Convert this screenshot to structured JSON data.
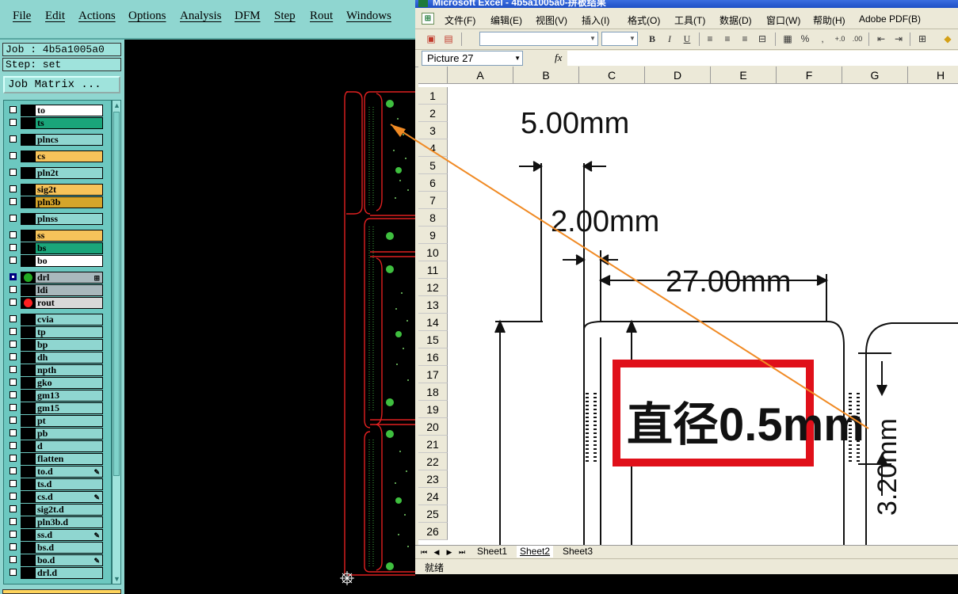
{
  "cam_app": {
    "menu": [
      "File",
      "Edit",
      "Actions",
      "Options",
      "Analysis",
      "DFM",
      "Step",
      "Rout",
      "Windows"
    ],
    "job_label": "Job : 4b5a1005a0",
    "step_label": "Step: set",
    "job_matrix_button": "Job Matrix ...",
    "layers": [
      {
        "name": "to",
        "color": "#ffffff"
      },
      {
        "name": "ts",
        "color": "#1aa57a"
      },
      {
        "name": "plncs",
        "color": "#8fd6d0"
      },
      {
        "name": "cs",
        "color": "#f6c35a"
      },
      {
        "name": "pln2t",
        "color": "#8fd6d0"
      },
      {
        "name": "sig2t",
        "color": "#f6c35a"
      },
      {
        "name": "pln3b",
        "color": "#d6a52a"
      },
      {
        "name": "plnss",
        "color": "#8fd6d0"
      },
      {
        "name": "ss",
        "color": "#f6c35a"
      },
      {
        "name": "bs",
        "color": "#1aa57a"
      },
      {
        "name": "bo",
        "color": "#ffffff"
      },
      {
        "name": "drl",
        "color": "#a9b8bc",
        "dot": "#22aa22",
        "flag": "⊞",
        "active": true
      },
      {
        "name": "ldi",
        "color": "#a9b8bc"
      },
      {
        "name": "rout",
        "color": "#d8d8d8",
        "dot": "#ff2020"
      },
      {
        "name": "cvia",
        "color": "#8fd6d0"
      },
      {
        "name": "tp",
        "color": "#8fd6d0"
      },
      {
        "name": "bp",
        "color": "#8fd6d0"
      },
      {
        "name": "dh",
        "color": "#8fd6d0"
      },
      {
        "name": "npth",
        "color": "#8fd6d0"
      },
      {
        "name": "gko",
        "color": "#8fd6d0"
      },
      {
        "name": "gm13",
        "color": "#8fd6d0"
      },
      {
        "name": "gm15",
        "color": "#8fd6d0"
      },
      {
        "name": "pt",
        "color": "#8fd6d0"
      },
      {
        "name": "pb",
        "color": "#8fd6d0"
      },
      {
        "name": "d",
        "color": "#8fd6d0"
      },
      {
        "name": "flatten",
        "color": "#8fd6d0"
      },
      {
        "name": "to.d",
        "color": "#8fd6d0",
        "flag": "✎"
      },
      {
        "name": "ts.d",
        "color": "#8fd6d0"
      },
      {
        "name": "cs.d",
        "color": "#8fd6d0",
        "flag": "✎"
      },
      {
        "name": "sig2t.d",
        "color": "#8fd6d0"
      },
      {
        "name": "pln3b.d",
        "color": "#8fd6d0"
      },
      {
        "name": "ss.d",
        "color": "#8fd6d0",
        "flag": "✎"
      },
      {
        "name": "bs.d",
        "color": "#8fd6d0"
      },
      {
        "name": "bo.d",
        "color": "#8fd6d0",
        "flag": "✎"
      },
      {
        "name": "drl.d",
        "color": "#8fd6d0"
      }
    ]
  },
  "excel": {
    "title": "Microsoft Excel - 4b5a1005a0-拼板结果",
    "menu": [
      "文件(F)",
      "编辑(E)",
      "视图(V)",
      "插入(I)",
      "格式(O)",
      "工具(T)",
      "数据(D)",
      "窗口(W)",
      "帮助(H)",
      "Adobe PDF(B)"
    ],
    "name_box": "Picture 27",
    "fx_label": "fx",
    "columns": [
      "A",
      "B",
      "C",
      "D",
      "E",
      "F",
      "G",
      "H"
    ],
    "rows": [
      "1",
      "2",
      "3",
      "4",
      "5",
      "6",
      "7",
      "8",
      "9",
      "10",
      "11",
      "12",
      "13",
      "14",
      "15",
      "16",
      "17",
      "18",
      "19",
      "20",
      "21",
      "22",
      "23",
      "24",
      "25",
      "26"
    ],
    "sheets": [
      "Sheet1",
      "Sheet2",
      "Sheet3"
    ],
    "active_sheet": "Sheet2",
    "status": "就绪",
    "picture": {
      "dim_1": "5.00mm",
      "dim_2": "2.00mm",
      "dim_3": "27.00mm",
      "dim_4": "3.20mm",
      "callout": "直径0.5mm"
    }
  },
  "annotation_color": "#f08a24"
}
